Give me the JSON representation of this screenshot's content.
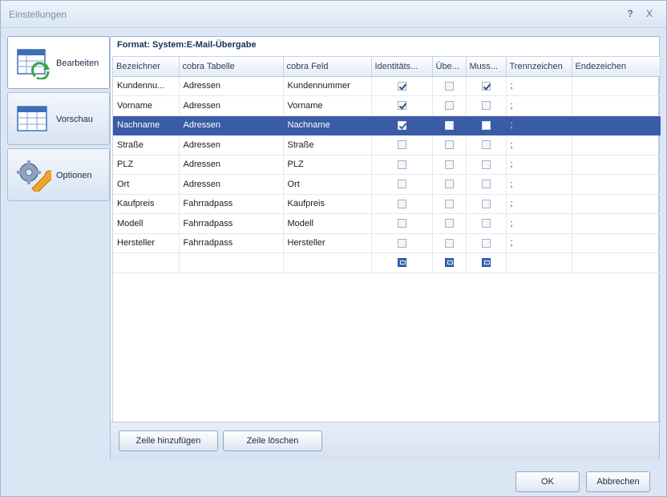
{
  "window": {
    "title": "Einstellungen",
    "help_label": "?",
    "close_label": "X"
  },
  "nav": {
    "items": [
      {
        "label": "Bearbeiten",
        "icon": "table-edit-icon"
      },
      {
        "label": "Vorschau",
        "icon": "table-preview-icon"
      },
      {
        "label": "Optionen",
        "icon": "gear-wrench-icon"
      }
    ],
    "active": "Bearbeiten"
  },
  "format_title": "Format: System:E-Mail-Übergabe",
  "table": {
    "columns": [
      "Bezeichner",
      "cobra Tabelle",
      "cobra Feld",
      "Identitäts...",
      "Übe...",
      "Muss...",
      "Trennzeichen",
      "Endezeichen"
    ],
    "rows": [
      {
        "bezeichner": "Kundennu...",
        "tabelle": "Adressen",
        "feld": "Kundennummer",
        "ident": "checked",
        "ueber": "unchecked",
        "muss": "checked",
        "trenn": ";",
        "ende": ""
      },
      {
        "bezeichner": "Vorname",
        "tabelle": "Adressen",
        "feld": "Vorname",
        "ident": "checked",
        "ueber": "unchecked",
        "muss": "unchecked",
        "trenn": ";",
        "ende": ""
      },
      {
        "bezeichner": "Nachname",
        "tabelle": "Adressen",
        "feld": "Nachname",
        "ident": "checked",
        "ueber": "filled",
        "muss": "unchecked",
        "trenn": ";",
        "ende": ""
      },
      {
        "bezeichner": "Straße",
        "tabelle": "Adressen",
        "feld": "Straße",
        "ident": "unchecked",
        "ueber": "unchecked",
        "muss": "unchecked",
        "trenn": ";",
        "ende": ""
      },
      {
        "bezeichner": "PLZ",
        "tabelle": "Adressen",
        "feld": "PLZ",
        "ident": "unchecked",
        "ueber": "unchecked",
        "muss": "unchecked",
        "trenn": ";",
        "ende": ""
      },
      {
        "bezeichner": "Ort",
        "tabelle": "Adressen",
        "feld": "Ort",
        "ident": "unchecked",
        "ueber": "unchecked",
        "muss": "unchecked",
        "trenn": ";",
        "ende": ""
      },
      {
        "bezeichner": "Kaufpreis",
        "tabelle": "Fahrradpass",
        "feld": "Kaufpreis",
        "ident": "unchecked",
        "ueber": "unchecked",
        "muss": "unchecked",
        "trenn": ";",
        "ende": ""
      },
      {
        "bezeichner": "Modell",
        "tabelle": "Fahrradpass",
        "feld": "Modell",
        "ident": "unchecked",
        "ueber": "unchecked",
        "muss": "unchecked",
        "trenn": ";",
        "ende": ""
      },
      {
        "bezeichner": "Hersteller",
        "tabelle": "Fahrradpass",
        "feld": "Hersteller",
        "ident": "unchecked",
        "ueber": "unchecked",
        "muss": "unchecked",
        "trenn": ";",
        "ende": ""
      },
      {
        "bezeichner": "",
        "tabelle": "",
        "feld": "",
        "ident": "filled",
        "ueber": "filled",
        "muss": "filled",
        "trenn": "",
        "ende": ""
      }
    ],
    "selected_row": 2
  },
  "buttons": {
    "add_row": "Zeile hinzufügen",
    "delete_row": "Zeile löschen",
    "ok": "OK",
    "cancel": "Abbrechen"
  },
  "colors": {
    "selection": "#3a5ba6",
    "frame": "#dbe6f4",
    "accent_green": "#3aa14a",
    "accent_orange": "#f2a424"
  }
}
